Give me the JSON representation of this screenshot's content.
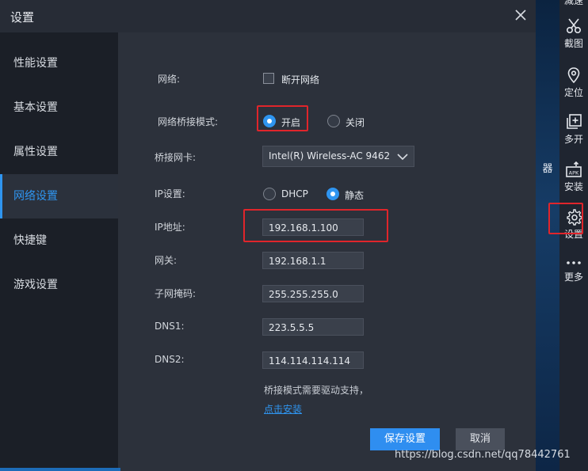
{
  "dialog": {
    "title": "设置",
    "close_label": "×"
  },
  "sidebar": {
    "items": [
      {
        "label": "性能设置",
        "active": false
      },
      {
        "label": "基本设置",
        "active": false
      },
      {
        "label": "属性设置",
        "active": false
      },
      {
        "label": "网络设置",
        "active": true
      },
      {
        "label": "快捷键",
        "active": false
      },
      {
        "label": "游戏设置",
        "active": false
      }
    ]
  },
  "network": {
    "network_label": "网络:",
    "disconnect_label": "断开网络",
    "disconnect_checked": false,
    "bridge_mode_label": "网络桥接模式:",
    "bridge_on_label": "开启",
    "bridge_off_label": "关闭",
    "bridge_mode_value": "开启",
    "adapter_label": "桥接网卡:",
    "adapter_value": "Intel(R) Wireless-AC 9462",
    "ip_setting_label": "IP设置:",
    "dhcp_label": "DHCP",
    "static_label": "静态",
    "ip_setting_value": "静态",
    "ip_label": "IP地址:",
    "ip_value": "192.168.1.100",
    "gateway_label": "网关:",
    "gateway_value": "192.168.1.1",
    "subnet_label": "子网掩码:",
    "subnet_value": "255.255.255.0",
    "dns1_label": "DNS1:",
    "dns1_value": "223.5.5.5",
    "dns2_label": "DNS2:",
    "dns2_value": "114.114.114.114",
    "driver_note": "桥接模式需要驱动支持，",
    "install_link": "点击安装"
  },
  "buttons": {
    "save": "保存设置",
    "cancel": "取消"
  },
  "toolbar": {
    "items": [
      {
        "label": "截图",
        "icon": "scissors-icon"
      },
      {
        "label": "定位",
        "icon": "location-pin-icon"
      },
      {
        "label": "多开",
        "icon": "multi-window-icon"
      },
      {
        "label": "安装",
        "icon": "apk-install-icon"
      },
      {
        "label": "设置",
        "icon": "gear-icon"
      },
      {
        "label": "更多",
        "icon": "more-dots-icon"
      }
    ],
    "partial_top_label": "减速"
  },
  "background_partial_text": "器",
  "watermark": "https://blog.csdn.net/qq78442761",
  "colors": {
    "accent": "#2f95f0",
    "highlight": "#e0252b",
    "dialog_bg": "#2c313b",
    "sidebar_bg": "#1b1f27"
  }
}
